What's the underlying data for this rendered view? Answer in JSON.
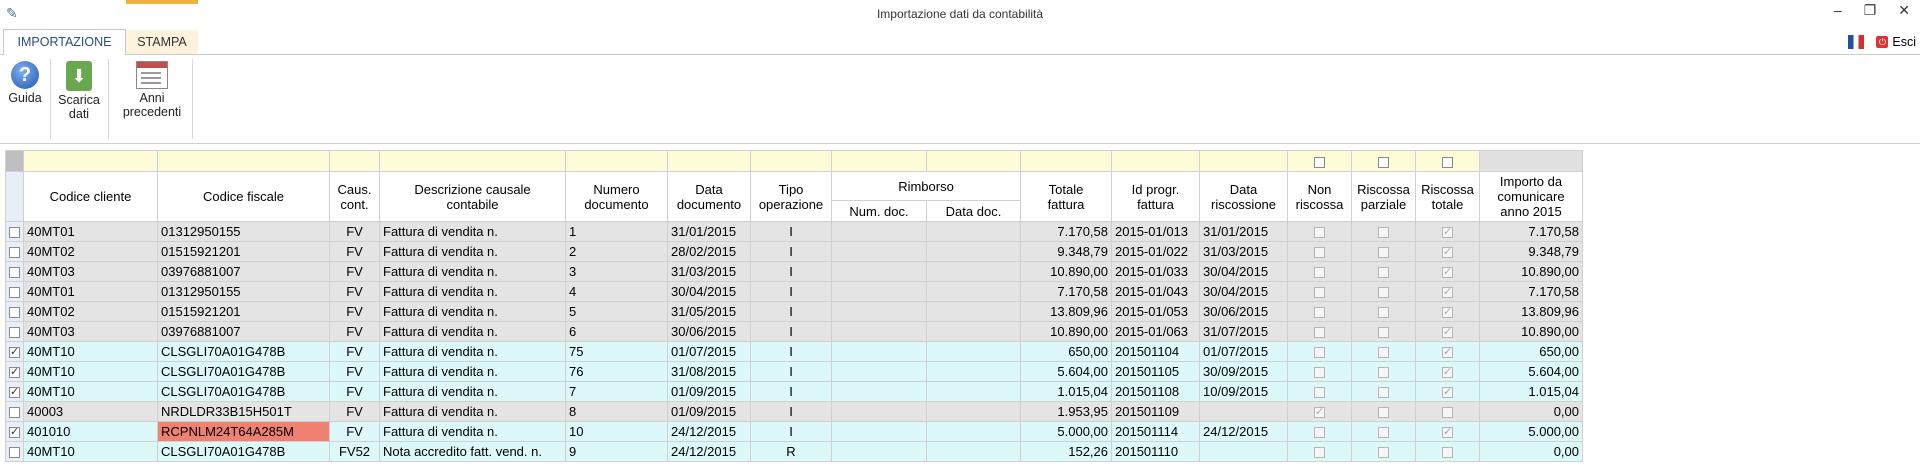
{
  "window": {
    "title": "Importazione dati da contabilità"
  },
  "tabs": [
    {
      "label": "IMPORTAZIONE",
      "active": true
    },
    {
      "label": "STAMPA",
      "active": false
    }
  ],
  "topright": {
    "exit_label": "Esci"
  },
  "ribbon": {
    "guida": "Guida",
    "scarica": [
      "Scarica",
      "dati"
    ],
    "anni": [
      "Anni",
      "precedenti"
    ]
  },
  "table": {
    "headers": {
      "codice_cliente": "Codice cliente",
      "codice_fiscale": "Codice fiscale",
      "caus": [
        "Caus.",
        "cont."
      ],
      "descrizione": [
        "Descrizione causale",
        "contabile"
      ],
      "numero": [
        "Numero",
        "documento"
      ],
      "data": [
        "Data",
        "documento"
      ],
      "tipo": [
        "Tipo",
        "operazione"
      ],
      "rimborso": "Rimborso",
      "num_doc": "Num. doc.",
      "data_doc": "Data doc.",
      "totale": [
        "Totale",
        "fattura"
      ],
      "id_progr": [
        "Id progr.",
        "fattura"
      ],
      "data_risc": [
        "Data",
        "riscossione"
      ],
      "non_risc": [
        "Non",
        "riscossa"
      ],
      "risc_parz": [
        "Riscossa",
        "parziale"
      ],
      "risc_tot": [
        "Riscossa",
        "totale"
      ],
      "importo": [
        "Importo da",
        "comunicare",
        "anno 2015"
      ]
    },
    "rows": [
      {
        "sel": false,
        "cliente": "40MT01",
        "cf": "01312950155",
        "caus": "FV",
        "desc": "Fattura di vendita n.",
        "num": "1",
        "data": "31/01/2015",
        "tipo": "I",
        "totale": "7.170,58",
        "id": "2015-01/013",
        "data_risc": "31/01/2015",
        "non": false,
        "parz": false,
        "tot": true,
        "importo": "7.170,58",
        "color": "g",
        "cf_err": false
      },
      {
        "sel": false,
        "cliente": "40MT02",
        "cf": "01515921201",
        "caus": "FV",
        "desc": "Fattura di vendita n.",
        "num": "2",
        "data": "28/02/2015",
        "tipo": "I",
        "totale": "9.348,79",
        "id": "2015-01/022",
        "data_risc": "31/03/2015",
        "non": false,
        "parz": false,
        "tot": true,
        "importo": "9.348,79",
        "color": "g",
        "cf_err": false
      },
      {
        "sel": false,
        "cliente": "40MT03",
        "cf": "03976881007",
        "caus": "FV",
        "desc": "Fattura di vendita n.",
        "num": "3",
        "data": "31/03/2015",
        "tipo": "I",
        "totale": "10.890,00",
        "id": "2015-01/033",
        "data_risc": "30/04/2015",
        "non": false,
        "parz": false,
        "tot": true,
        "importo": "10.890,00",
        "color": "g",
        "cf_err": false
      },
      {
        "sel": false,
        "cliente": "40MT01",
        "cf": "01312950155",
        "caus": "FV",
        "desc": "Fattura di vendita n.",
        "num": "4",
        "data": "30/04/2015",
        "tipo": "I",
        "totale": "7.170,58",
        "id": "2015-01/043",
        "data_risc": "30/04/2015",
        "non": false,
        "parz": false,
        "tot": true,
        "importo": "7.170,58",
        "color": "g",
        "cf_err": false
      },
      {
        "sel": false,
        "cliente": "40MT02",
        "cf": "01515921201",
        "caus": "FV",
        "desc": "Fattura di vendita n.",
        "num": "5",
        "data": "31/05/2015",
        "tipo": "I",
        "totale": "13.809,96",
        "id": "2015-01/053",
        "data_risc": "30/06/2015",
        "non": false,
        "parz": false,
        "tot": true,
        "importo": "13.809,96",
        "color": "g",
        "cf_err": false
      },
      {
        "sel": false,
        "cliente": "40MT03",
        "cf": "03976881007",
        "caus": "FV",
        "desc": "Fattura di vendita n.",
        "num": "6",
        "data": "30/06/2015",
        "tipo": "I",
        "totale": "10.890,00",
        "id": "2015-01/063",
        "data_risc": "31/07/2015",
        "non": false,
        "parz": false,
        "tot": true,
        "importo": "10.890,00",
        "color": "g",
        "cf_err": false
      },
      {
        "sel": true,
        "cliente": "40MT10",
        "cf": "CLSGLI70A01G478B",
        "caus": "FV",
        "desc": "Fattura di vendita n.",
        "num": "75",
        "data": "01/07/2015",
        "tipo": "I",
        "totale": "650,00",
        "id": "201501104",
        "data_risc": "01/07/2015",
        "non": false,
        "parz": false,
        "tot": true,
        "importo": "650,00",
        "color": "c",
        "cf_err": false
      },
      {
        "sel": true,
        "cliente": "40MT10",
        "cf": "CLSGLI70A01G478B",
        "caus": "FV",
        "desc": "Fattura di vendita n.",
        "num": "76",
        "data": "31/08/2015",
        "tipo": "I",
        "totale": "5.604,00",
        "id": "201501105",
        "data_risc": "30/09/2015",
        "non": false,
        "parz": false,
        "tot": true,
        "importo": "5.604,00",
        "color": "c",
        "cf_err": false
      },
      {
        "sel": true,
        "cliente": "40MT10",
        "cf": "CLSGLI70A01G478B",
        "caus": "FV",
        "desc": "Fattura di vendita n.",
        "num": "7",
        "data": "01/09/2015",
        "tipo": "I",
        "totale": "1.015,04",
        "id": "201501108",
        "data_risc": "10/09/2015",
        "non": false,
        "parz": false,
        "tot": true,
        "importo": "1.015,04",
        "color": "c",
        "cf_err": false
      },
      {
        "sel": false,
        "cliente": "40003",
        "cf": "NRDLDR33B15H501T",
        "caus": "FV",
        "desc": "Fattura di vendita n.",
        "num": "8",
        "data": "01/09/2015",
        "tipo": "I",
        "totale": "1.953,95",
        "id": "201501109",
        "data_risc": "",
        "non": true,
        "parz": false,
        "tot": false,
        "importo": "0,00",
        "color": "g",
        "cf_err": false
      },
      {
        "sel": true,
        "cliente": "401010",
        "cf": "RCPNLM24T64A285M",
        "caus": "FV",
        "desc": "Fattura di vendita n.",
        "num": "10",
        "data": "24/12/2015",
        "tipo": "I",
        "totale": "5.000,00",
        "id": "201501114",
        "data_risc": "24/12/2015",
        "non": false,
        "parz": false,
        "tot": true,
        "importo": "5.000,00",
        "color": "c",
        "cf_err": true
      },
      {
        "sel": false,
        "cliente": "40MT10",
        "cf": "CLSGLI70A01G478B",
        "caus": "FV52",
        "desc": "Nota accredito fatt. vend. n.",
        "num": "9",
        "data": "24/12/2015",
        "tipo": "R",
        "totale": "152,26",
        "id": "201501110",
        "data_risc": "",
        "non": false,
        "parz": false,
        "tot": false,
        "importo": "0,00",
        "color": "c",
        "cf_err": false
      }
    ]
  }
}
